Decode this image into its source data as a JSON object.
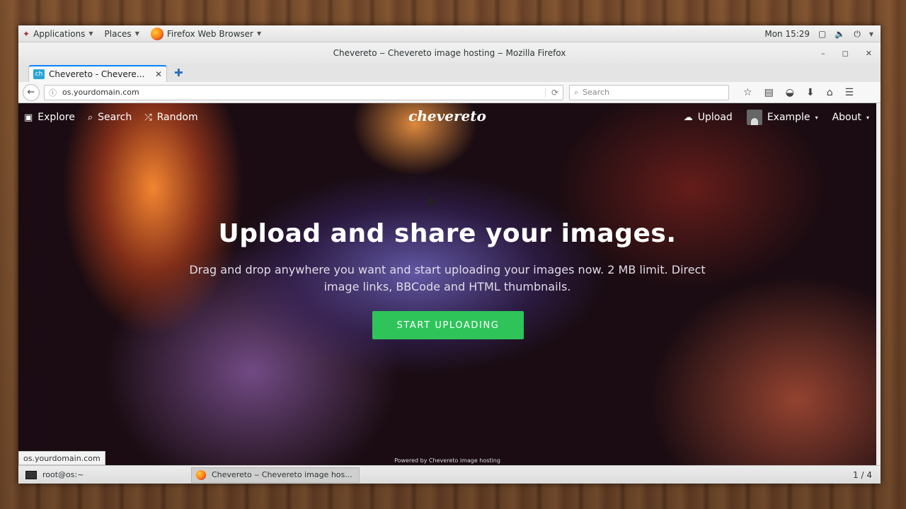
{
  "gnome": {
    "applications": "Applications",
    "places": "Places",
    "firefox": "Firefox Web Browser",
    "clock": "Mon 15:29"
  },
  "window": {
    "title": "Chevereto ‒ Chevereto image hosting ‒ Mozilla Firefox"
  },
  "tab": {
    "favicon": "ch",
    "title": "Chevereto - Chevere..."
  },
  "navbar": {
    "url": "os.yourdomain.com",
    "search_placeholder": "Search"
  },
  "site": {
    "nav": {
      "explore": "Explore",
      "search": "Search",
      "random": "Random"
    },
    "logo": "chevereto",
    "upload": "Upload",
    "user": "Example",
    "about": "About"
  },
  "hero": {
    "title": "Upload and share your images.",
    "subtitle": "Drag and drop anywhere you want and start uploading your images now. 2 MB limit. Direct image links, BBCode and HTML thumbnails.",
    "cta": "START UPLOADING"
  },
  "footer": {
    "powered": "Powered by Chevereto image hosting"
  },
  "status_url": "os.yourdomain.com",
  "taskbar": {
    "terminal": "root@os:~",
    "firefox": "Chevereto ‒ Chevereto image hos...",
    "workspace": "1 / 4"
  },
  "colors": {
    "cta": "#2ec45a",
    "tab_accent": "#0a84ff"
  }
}
